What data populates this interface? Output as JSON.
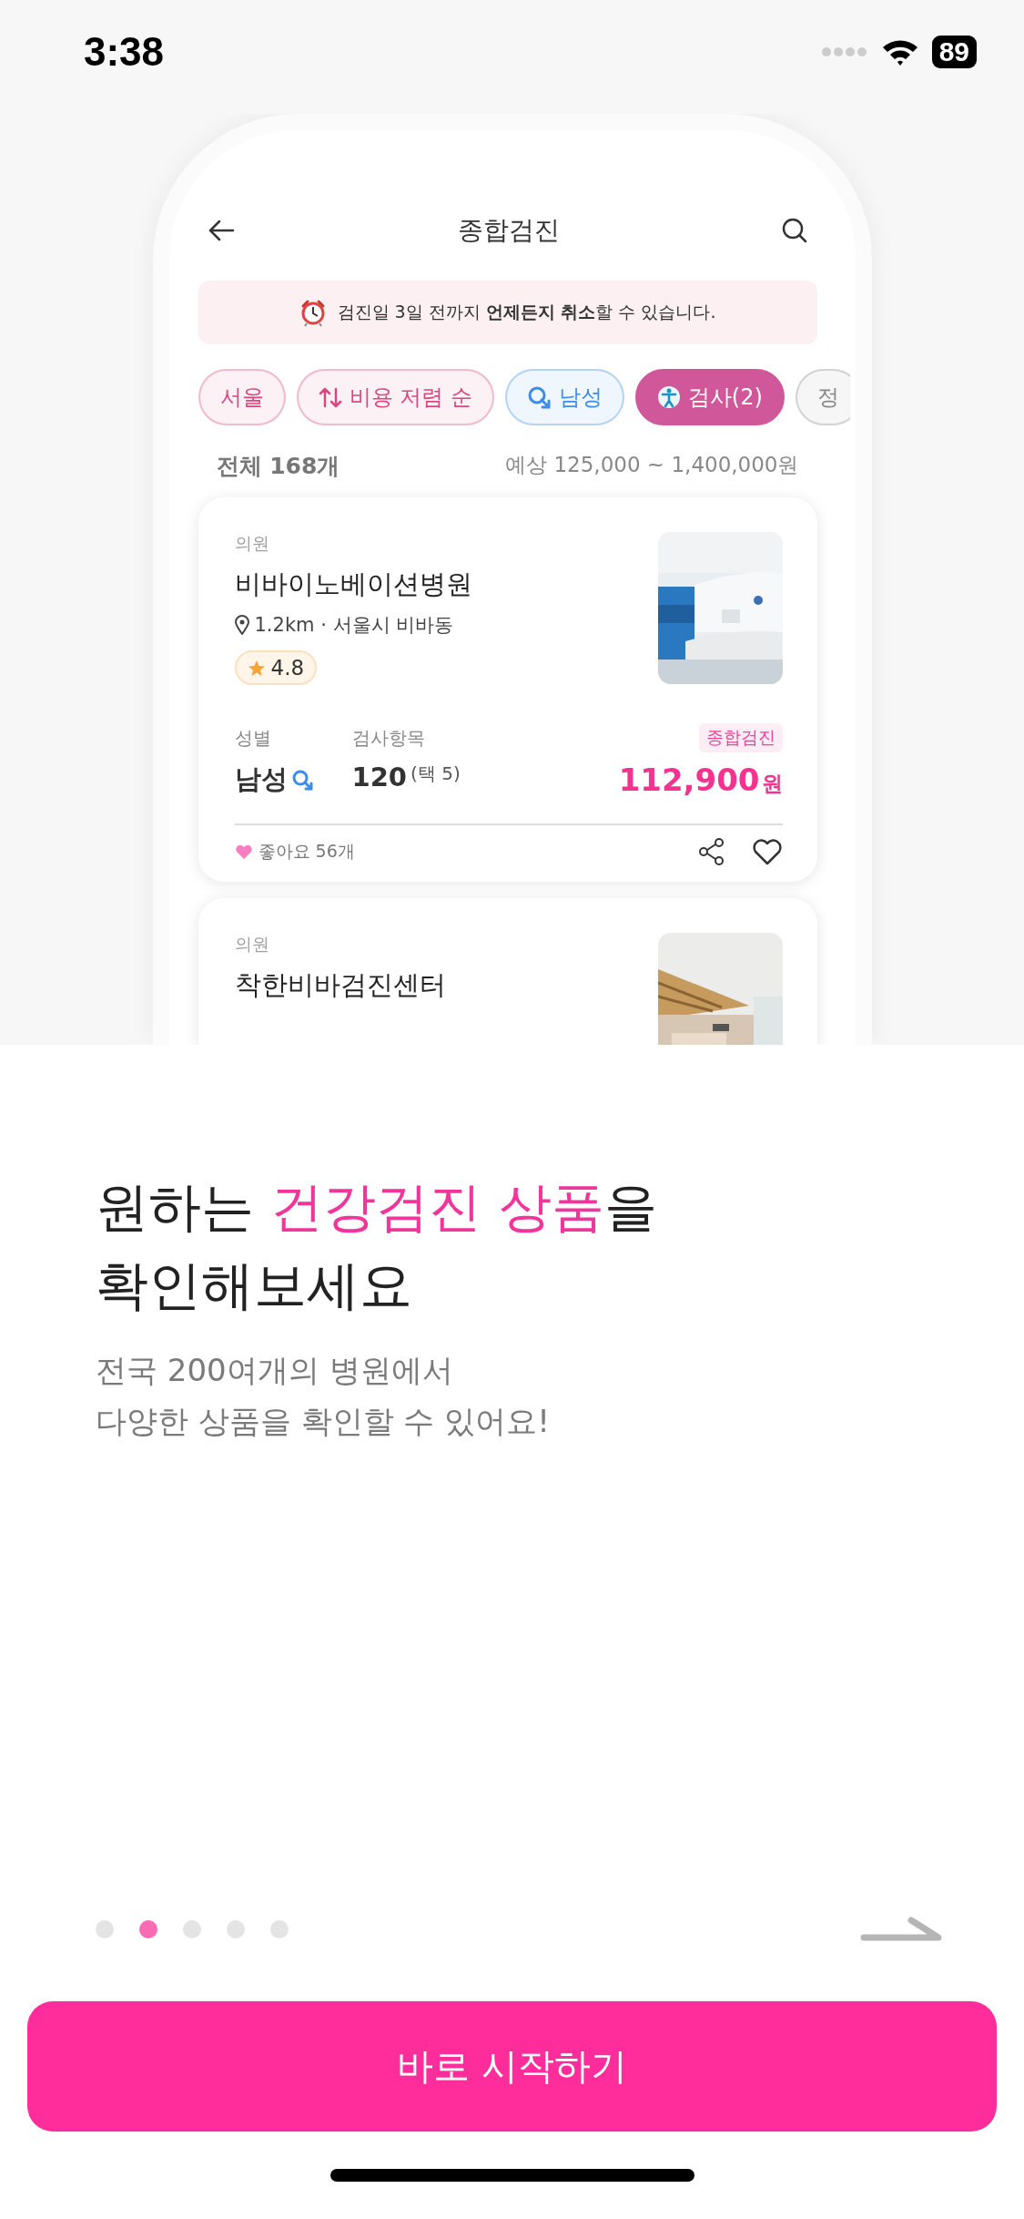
{
  "status_bar": {
    "time": "3:38",
    "battery": "89"
  },
  "mockup": {
    "header": {
      "title": "종합검진"
    },
    "notice": "검진일 3일 전까지 **언제든지 취소**할 수 있습니다.",
    "filters": [
      {
        "label": "서울",
        "kind": "plain",
        "color": "#d9487f",
        "selected": false
      },
      {
        "label": "비용 저렴 순",
        "kind": "sort",
        "color": "#d9487f",
        "selected": false
      },
      {
        "label": "남성",
        "kind": "gender",
        "color": "#3d8ce8",
        "selected": false
      },
      {
        "label": "검사(2)",
        "kind": "test",
        "color": "#d0589a",
        "selected": true
      },
      {
        "label": "정",
        "kind": "plain",
        "color": "#8a8a8a",
        "selected": false
      }
    ],
    "summary": {
      "total": "전체 168개",
      "range": "예상 125,000 ~ 1,400,000원"
    },
    "cards": [
      {
        "category": "의원",
        "name": "비바이노베이션병원",
        "distance": "1.2km · 서울시 비바동",
        "rating": "4.8",
        "gender_label": "성별",
        "gender": "남성",
        "items_label": "검사항목",
        "items": "120",
        "items_note": "(택 5)",
        "tag": "종합검진",
        "price": "112,900",
        "currency": "원",
        "likes": "좋아요 56개"
      },
      {
        "category": "의원",
        "name": "착한비바검진센터"
      }
    ]
  },
  "onboarding": {
    "title": "원하는 **건강검진 상품**을\n확인해보세요",
    "subtitle": "전국 200여개의 병원에서\n다양한 상품을 확인할 수 있어요!"
  },
  "pager": [
    {
      "selected": false
    },
    {
      "selected": true
    },
    {
      "selected": false
    },
    {
      "selected": false
    },
    {
      "selected": false
    }
  ],
  "start_button": "바로 시작하기"
}
